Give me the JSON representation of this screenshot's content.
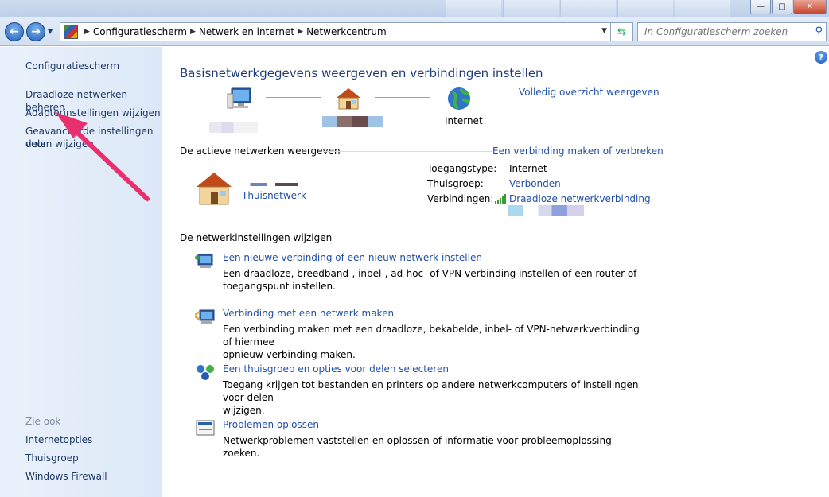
{
  "window": {
    "close_glyph": "✕",
    "maximize_glyph": "□",
    "minimize_glyph": "—"
  },
  "address": {
    "crumbs": [
      "Configuratiescherm",
      "Netwerk en internet",
      "Netwerkcentrum"
    ],
    "search_placeholder": "In Configuratiescherm zoeken"
  },
  "sidebar": {
    "home": "Configuratiescherm",
    "items": [
      "Draadloze netwerken beheren",
      "Adapterinstellingen wijzigen",
      "Geavanceerde instellingen voor",
      "delen wijzigen"
    ],
    "see_also_title": "Zie ook",
    "see_also": [
      "Internetopties",
      "Thuisgroep",
      "Windows Firewall"
    ]
  },
  "main": {
    "title": "Basisnetwerkgegevens weergeven en verbindingen instellen",
    "full_map_link": "Volledig overzicht weergeven",
    "internet_label": "Internet",
    "active_title": "De actieve netwerken weergeven",
    "connect_link": "Een verbinding maken of verbreken",
    "network_name": "Thuisnetwerk",
    "access_type_label": "Toegangstype:",
    "access_type_value": "Internet",
    "homegroup_label": "Thuisgroep:",
    "homegroup_value": "Verbonden",
    "connections_label": "Verbindingen:",
    "connections_value": "Draadloze netwerkverbinding",
    "change_title": "De netwerkinstellingen wijzigen",
    "tasks": [
      {
        "title": "Een nieuwe verbinding of een nieuw netwerk instellen",
        "desc1": "Een draadloze, breedband-, inbel-, ad-hoc- of VPN-verbinding instellen of een router of",
        "desc2": "toegangspunt instellen."
      },
      {
        "title": "Verbinding met een netwerk maken",
        "desc1": "Een verbinding maken met een draadloze, bekabelde, inbel- of VPN-netwerkverbinding of hiermee",
        "desc2": "opnieuw verbinding maken."
      },
      {
        "title": "Een thuisgroep en opties voor delen selecteren",
        "desc1": "Toegang krijgen tot bestanden en printers op andere netwerkcomputers of instellingen voor delen",
        "desc2": "wijzigen."
      },
      {
        "title": "Problemen oplossen",
        "desc1": "Netwerkproblemen vaststellen en oplossen of informatie voor probleemoplossing zoeken.",
        "desc2": ""
      }
    ]
  },
  "colors": {
    "link": "#1f4fa8",
    "title": "#1f3b7a",
    "sidebar_bg": "#dce8f7",
    "annotation_arrow": "#e8306e"
  },
  "icons": {
    "back": "arrow-left-icon",
    "forward": "arrow-right-icon",
    "help": "help-icon",
    "computer": "computer-icon",
    "house": "house-icon",
    "globe": "globe-icon",
    "signal": "signal-bars-icon"
  }
}
